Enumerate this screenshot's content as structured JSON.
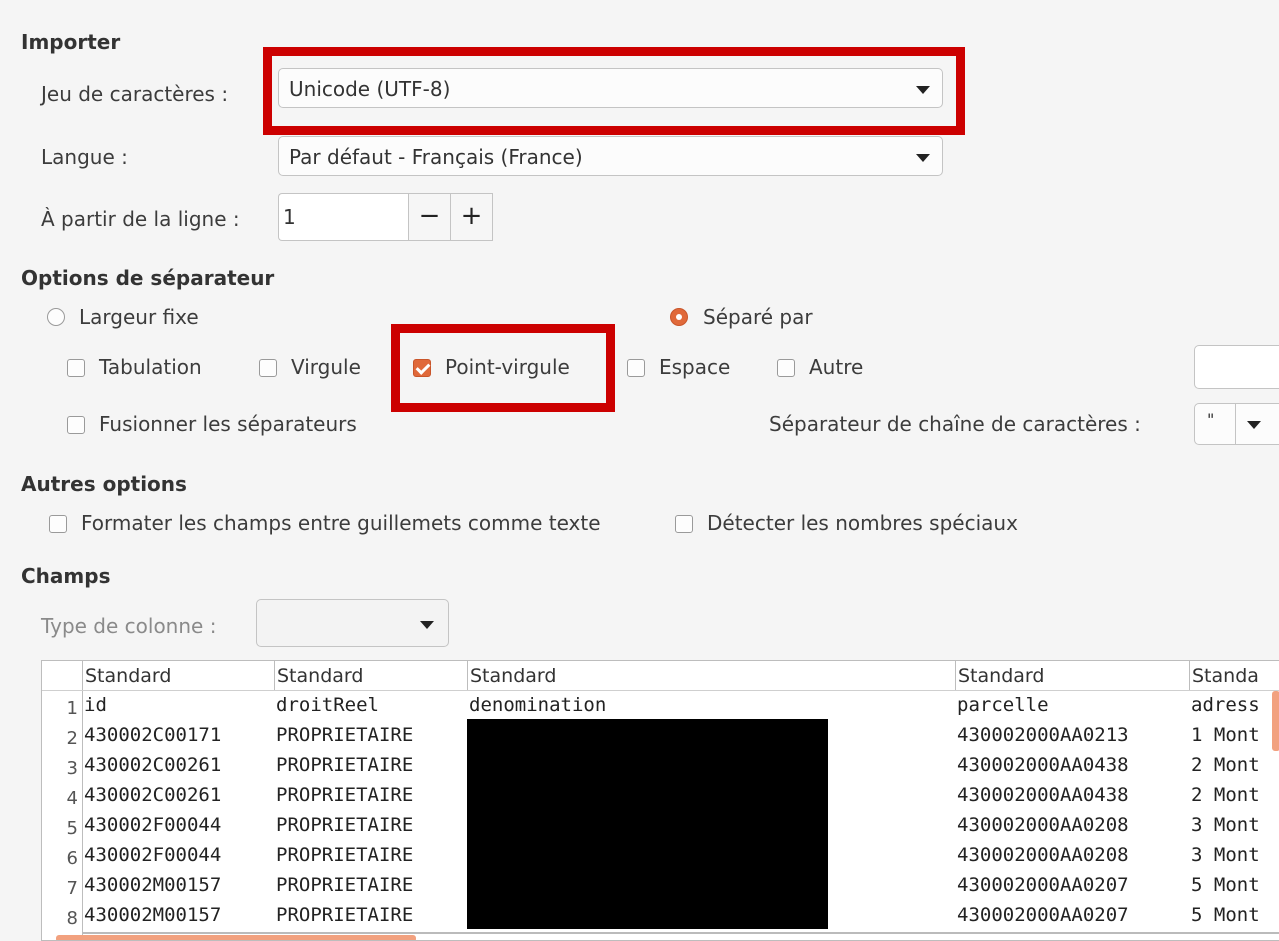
{
  "importer": {
    "title": "Importer",
    "charset_label": "Jeu de caractères :",
    "charset_value": "Unicode (UTF-8)",
    "language_label": "Langue :",
    "language_value": "Par défaut - Français (France)",
    "from_row_label": "À partir de la ligne :",
    "from_row_value": "1",
    "minus": "−",
    "plus": "+"
  },
  "separator": {
    "title": "Options de séparateur",
    "fixed_width": "Largeur fixe",
    "separated_by": "Séparé par",
    "tab": "Tabulation",
    "comma": "Virgule",
    "semicolon": "Point-virgule",
    "space": "Espace",
    "other": "Autre",
    "merge": "Fusionner les séparateurs",
    "string_delim_label": "Séparateur de chaîne de caractères :",
    "string_delim_value": "\""
  },
  "other_options": {
    "title": "Autres options",
    "quoted_as_text": "Formater les champs entre guillemets comme texte",
    "detect_special": "Détecter les nombres spéciaux"
  },
  "fields": {
    "title": "Champs",
    "column_type_label": "Type de colonne :"
  },
  "preview": {
    "headers": [
      "Standard",
      "Standard",
      "Standard",
      "Standard",
      "Standa"
    ],
    "rows": [
      {
        "n": "1",
        "c": [
          "id",
          "droitReel",
          "denomination",
          "parcelle",
          "adress"
        ]
      },
      {
        "n": "2",
        "c": [
          "430002C00171",
          "PROPRIETAIRE",
          "",
          "430002000AA0213",
          "1 Mont"
        ]
      },
      {
        "n": "3",
        "c": [
          "430002C00261",
          "PROPRIETAIRE",
          "",
          "430002000AA0438",
          "2 Mont"
        ]
      },
      {
        "n": "4",
        "c": [
          "430002C00261",
          "PROPRIETAIRE",
          "",
          "430002000AA0438",
          "2 Mont"
        ]
      },
      {
        "n": "5",
        "c": [
          "430002F00044",
          "PROPRIETAIRE",
          "",
          "430002000AA0208",
          "3 Mont"
        ]
      },
      {
        "n": "6",
        "c": [
          "430002F00044",
          "PROPRIETAIRE",
          "",
          "430002000AA0208",
          "3 Mont"
        ]
      },
      {
        "n": "7",
        "c": [
          "430002M00157",
          "PROPRIETAIRE",
          "",
          "430002000AA0207",
          "5 Mont"
        ]
      },
      {
        "n": "8",
        "c": [
          "430002M00157",
          "PROPRIETAIRE",
          "",
          "430002000AA0207",
          "5 Mont"
        ]
      }
    ]
  },
  "colors": {
    "accent": "#e0693a",
    "highlight": "#cc0000",
    "scrollbar": "#f2a17f"
  }
}
